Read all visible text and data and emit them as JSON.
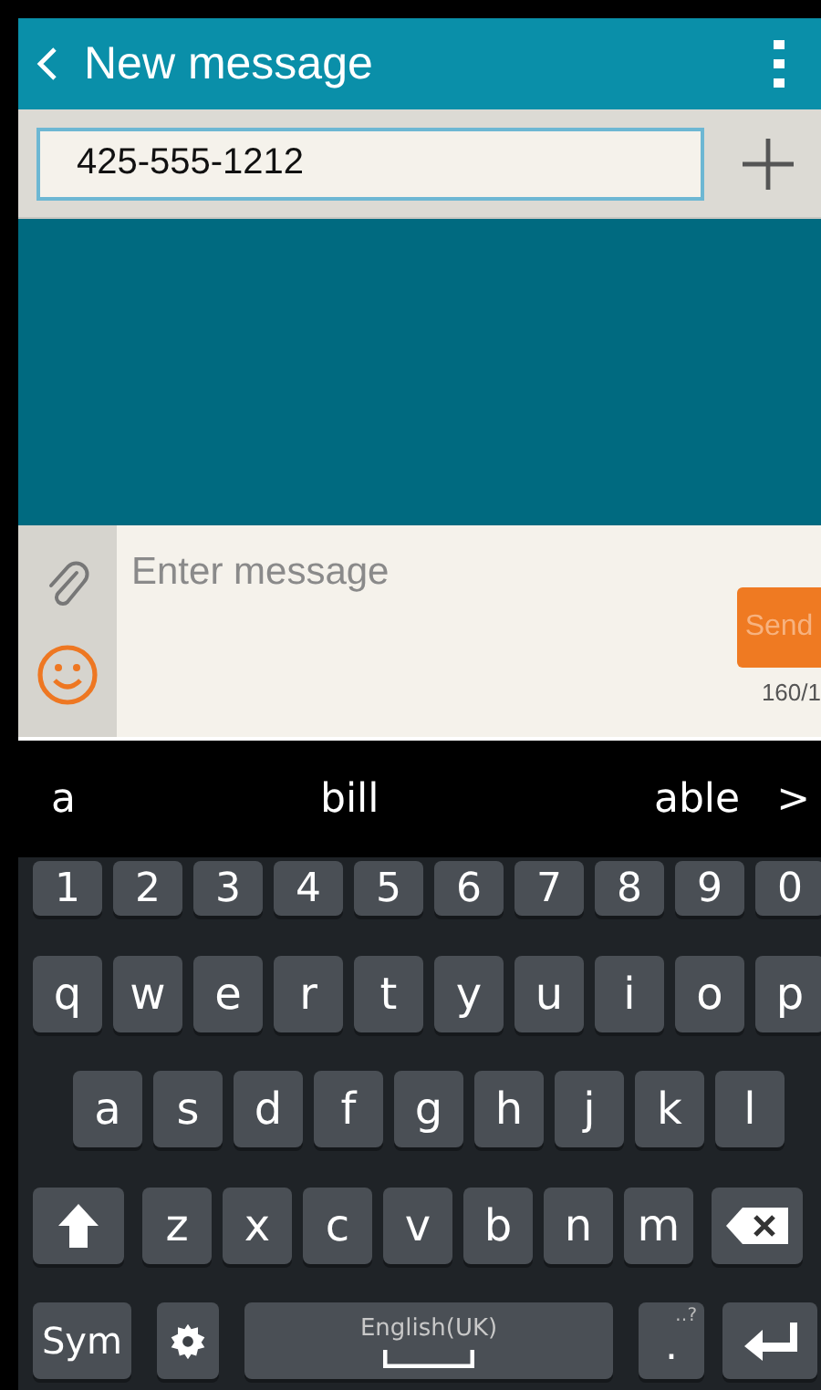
{
  "app_bar": {
    "title": "New message"
  },
  "recipient": {
    "value": "425-555-1212"
  },
  "compose": {
    "placeholder": "Enter message",
    "send_label": "Send",
    "counter": "160/1"
  },
  "suggestions": [
    {
      "text": "a"
    },
    {
      "text": "bill"
    },
    {
      "text": "able"
    },
    {
      "text": ">"
    }
  ],
  "keyboard": {
    "rows": [
      {
        "keys": [
          {
            "kind": "char",
            "label": "1"
          },
          {
            "kind": "char",
            "label": "2"
          },
          {
            "kind": "char",
            "label": "3"
          },
          {
            "kind": "char",
            "label": "4"
          },
          {
            "kind": "char",
            "label": "5"
          },
          {
            "kind": "char",
            "label": "6"
          },
          {
            "kind": "char",
            "label": "7"
          },
          {
            "kind": "char",
            "label": "8"
          },
          {
            "kind": "char",
            "label": "9"
          },
          {
            "kind": "char",
            "label": "0"
          }
        ]
      },
      {
        "keys": [
          {
            "kind": "char",
            "label": "q"
          },
          {
            "kind": "char",
            "label": "w"
          },
          {
            "kind": "char",
            "label": "e"
          },
          {
            "kind": "char",
            "label": "r"
          },
          {
            "kind": "char",
            "label": "t"
          },
          {
            "kind": "char",
            "label": "y"
          },
          {
            "kind": "char",
            "label": "u"
          },
          {
            "kind": "char",
            "label": "i"
          },
          {
            "kind": "char",
            "label": "o"
          },
          {
            "kind": "char",
            "label": "p"
          }
        ]
      },
      {
        "keys": [
          {
            "kind": "char",
            "label": "a"
          },
          {
            "kind": "char",
            "label": "s"
          },
          {
            "kind": "char",
            "label": "d"
          },
          {
            "kind": "char",
            "label": "f"
          },
          {
            "kind": "char",
            "label": "g"
          },
          {
            "kind": "char",
            "label": "h"
          },
          {
            "kind": "char",
            "label": "j"
          },
          {
            "kind": "char",
            "label": "k"
          },
          {
            "kind": "char",
            "label": "l"
          }
        ]
      },
      {
        "keys": [
          {
            "kind": "shift"
          },
          {
            "kind": "char",
            "label": "z"
          },
          {
            "kind": "char",
            "label": "x"
          },
          {
            "kind": "char",
            "label": "c"
          },
          {
            "kind": "char",
            "label": "v"
          },
          {
            "kind": "char",
            "label": "b"
          },
          {
            "kind": "char",
            "label": "n"
          },
          {
            "kind": "char",
            "label": "m"
          },
          {
            "kind": "backspace"
          }
        ]
      },
      {
        "keys": [
          {
            "kind": "sym",
            "label": "Sym"
          },
          {
            "kind": "settings"
          },
          {
            "kind": "space",
            "label": "English(UK)"
          },
          {
            "kind": "period",
            "label": ".",
            "hint": "‥?"
          },
          {
            "kind": "enter"
          }
        ]
      }
    ]
  }
}
